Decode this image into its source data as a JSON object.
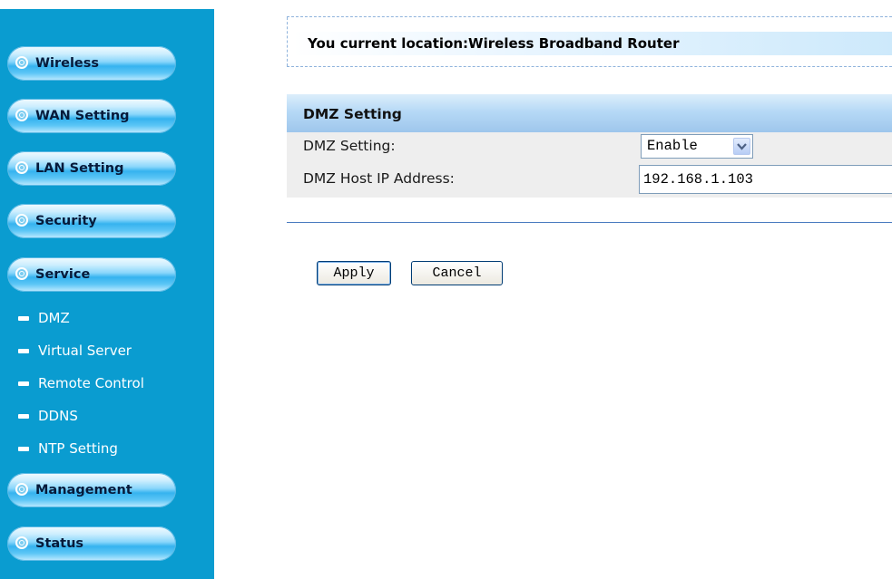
{
  "sidebar": {
    "menu": [
      {
        "label": "Wireless"
      },
      {
        "label": "WAN Setting"
      },
      {
        "label": "LAN Setting"
      },
      {
        "label": "Security"
      },
      {
        "label": "Service"
      },
      {
        "label": "Management"
      },
      {
        "label": "Status"
      }
    ],
    "service_items": [
      {
        "label": "DMZ"
      },
      {
        "label": "Virtual Server"
      },
      {
        "label": "Remote Control"
      },
      {
        "label": "DDNS"
      },
      {
        "label": "NTP Setting"
      }
    ]
  },
  "location": {
    "text": "You current location:Wireless Broadband Router"
  },
  "section": {
    "title": "DMZ Setting"
  },
  "form": {
    "dmz_label": "DMZ Setting:",
    "dmz_value": "Enable",
    "host_label": "DMZ Host IP Address:",
    "host_value": "192.168.1.103"
  },
  "buttons": {
    "apply": "Apply",
    "cancel": "Cancel"
  },
  "colors": {
    "sidebar_bg": "#0a9cd0",
    "header_blue": "#b6d9f6",
    "divider": "#4a7bbf"
  }
}
